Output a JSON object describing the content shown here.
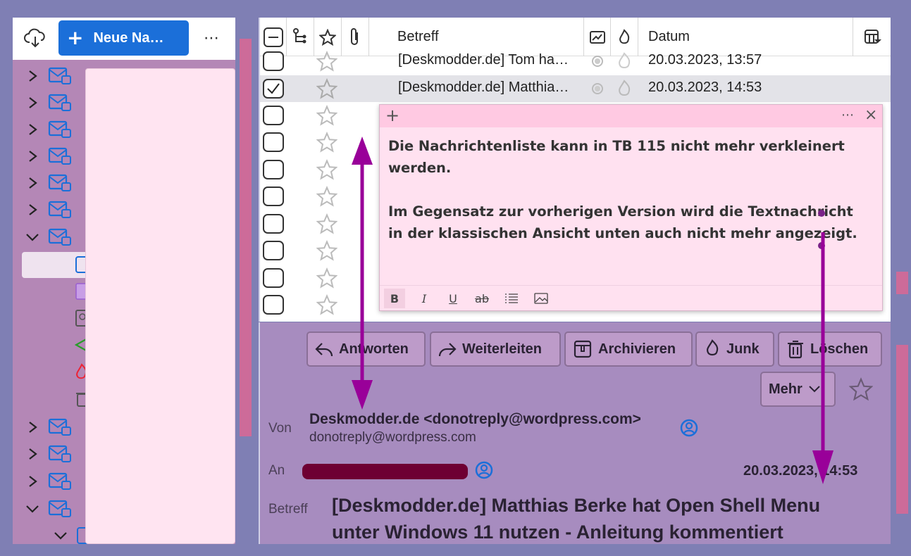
{
  "toolbar": {
    "new_message_label": "Neue Na…",
    "more_label": "⋯"
  },
  "list": {
    "headers": {
      "subject": "Betreff",
      "date": "Datum"
    },
    "rows": [
      {
        "subject": "[Deskmodder.de] Tom ha…",
        "date": "20.03.2023, 13:57",
        "checked": false,
        "selected": false
      },
      {
        "subject": "[Deskmodder.de] Matthia…",
        "date": "20.03.2023, 14:53",
        "checked": true,
        "selected": true
      },
      {
        "subject": "",
        "date": ""
      },
      {
        "subject": "",
        "date": ""
      },
      {
        "subject": "",
        "date": ""
      },
      {
        "subject": "",
        "date": ""
      },
      {
        "subject": "",
        "date": ""
      },
      {
        "subject": "",
        "date": ""
      },
      {
        "subject": "",
        "date": ""
      },
      {
        "subject": "",
        "date": ""
      }
    ]
  },
  "note": {
    "line1": "Die Nachrichtenliste kann in TB 115 nicht mehr verkleinert werden.",
    "line2": "Im Gegensatz zur vorherigen Version wird die Textnachricht in der klassischen Ansicht unten auch nicht mehr angezeigt.",
    "add_label": "+",
    "menu_label": "⋯",
    "close_label": "×",
    "fmt_bold": "B",
    "fmt_italic": "I",
    "fmt_underline": "U",
    "fmt_strike": "ab"
  },
  "preview": {
    "buttons": {
      "reply": "Antworten",
      "forward": "Weiterleiten",
      "archive": "Archivieren",
      "junk": "Junk",
      "delete": "Löschen",
      "more": "Mehr"
    },
    "from_label": "Von",
    "from_name": "Deskmodder.de <donotreply@wordpress.com>",
    "from_email": "donotreply@wordpress.com",
    "to_label": "An",
    "date": "20.03.2023, 14:53",
    "subject_label": "Betreff",
    "subject_line1": "[Deskmodder.de] Matthias Berke hat Open Shell Menu",
    "subject_line2": "unter Windows 11 nutzen - Anleitung kommentiert"
  },
  "colors": {
    "accent": "#1b6fd9",
    "annotation_arrow": "#990099",
    "redaction": "#6e0033",
    "note_bg": "#ffe1f0"
  }
}
